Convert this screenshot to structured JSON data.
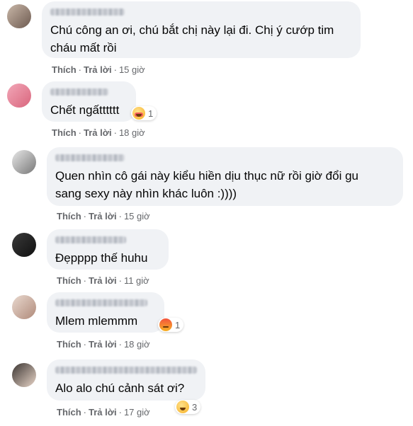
{
  "comments": [
    {
      "text": "Chú công an ơi, chú bắt chị này lại đi. Chị ý cướp tim\ncháu mất rồi",
      "like": "Thích",
      "reply": "Trả lời",
      "time": "15 giờ",
      "avatar_colors": [
        "#c9b7a8",
        "#6d5a50"
      ]
    },
    {
      "text": "Chết ngấtttttt",
      "like": "Thích",
      "reply": "Trả lời",
      "time": "18 giờ",
      "reaction": {
        "icon": "care-reaction-icon",
        "count": "1"
      },
      "avatar_colors": [
        "#f2a7b8",
        "#d9667d"
      ]
    },
    {
      "text": "Quen nhìn cô gái này kiểu hiền dịu thục nữ rồi giờ đổi gu\nsang sexy này nhìn khác luôn :))))",
      "like": "Thích",
      "reply": "Trả lời",
      "time": "15 giờ",
      "avatar_colors": [
        "#e8e8e8",
        "#777777"
      ]
    },
    {
      "text": "Đẹpppp thế huhu",
      "like": "Thích",
      "reply": "Trả lời",
      "time": "11 giờ",
      "avatar_colors": [
        "#3a3a3a",
        "#101010"
      ]
    },
    {
      "text": "Mlem mlemmm",
      "like": "Thích",
      "reply": "Trả lời",
      "time": "18 giờ",
      "reaction": {
        "icon": "angry-reaction-icon",
        "count": "1"
      },
      "avatar_colors": [
        "#e9d9cf",
        "#b08a7a"
      ]
    },
    {
      "text": "Alo alo chú cảnh sát ơi?",
      "like": "Thích",
      "reply": "Trả lời",
      "time": "17 giờ",
      "reaction": {
        "icon": "haha-reaction-icon",
        "count": "3"
      },
      "avatar_colors": [
        "#3b3532",
        "#e8d5c8"
      ]
    }
  ]
}
